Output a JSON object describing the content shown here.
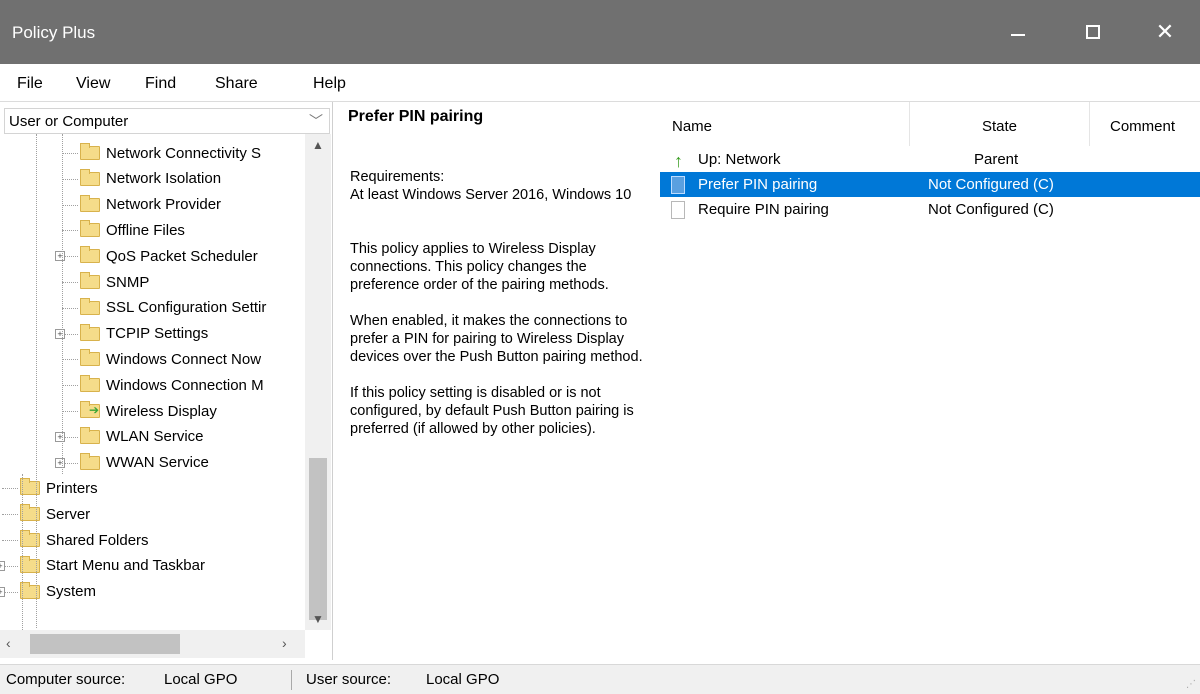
{
  "window": {
    "title": "Policy Plus"
  },
  "menu": [
    "File",
    "View",
    "Find",
    "Share",
    "Help"
  ],
  "tree": {
    "combo_value": "User or Computer",
    "items": [
      {
        "label": "Network Connectivity S",
        "indent": 1
      },
      {
        "label": "Network Isolation",
        "indent": 1
      },
      {
        "label": "Network Provider",
        "indent": 1
      },
      {
        "label": "Offline Files",
        "indent": 1
      },
      {
        "label": "QoS Packet Scheduler",
        "indent": 1,
        "expander": "+"
      },
      {
        "label": "SNMP",
        "indent": 1
      },
      {
        "label": "SSL Configuration Settir",
        "indent": 1
      },
      {
        "label": "TCPIP Settings",
        "indent": 1,
        "expander": "+"
      },
      {
        "label": "Windows Connect Now",
        "indent": 1
      },
      {
        "label": "Windows Connection M",
        "indent": 1
      },
      {
        "label": "Wireless Display",
        "indent": 1,
        "selected": true
      },
      {
        "label": "WLAN Service",
        "indent": 1,
        "expander": "+"
      },
      {
        "label": "WWAN Service",
        "indent": 1,
        "expander": "+"
      },
      {
        "label": "Printers",
        "indent": 0
      },
      {
        "label": "Server",
        "indent": 0
      },
      {
        "label": "Shared Folders",
        "indent": 0
      },
      {
        "label": "Start Menu and Taskbar",
        "indent": 0,
        "expander": "+"
      },
      {
        "label": "System",
        "indent": 0,
        "expander": "+"
      }
    ]
  },
  "description": {
    "title": "Prefer PIN pairing",
    "requirements_label": "Requirements:",
    "requirements_value": "At least Windows Server 2016, Windows 10",
    "para1": "This policy applies to Wireless Display connections. This policy changes the preference order of the pairing methods.",
    "para2": "When enabled, it makes the connections to prefer a PIN for pairing to Wireless Display devices over the Push Button pairing method.",
    "para3": "If this policy setting is disabled or is not configured, by default Push Button pairing is preferred (if allowed by other policies)."
  },
  "list": {
    "headers": {
      "name": "Name",
      "state": "State",
      "comment": "Comment"
    },
    "rows": [
      {
        "name": "Up: Network",
        "state": "Parent",
        "kind": "up"
      },
      {
        "name": "Prefer PIN pairing",
        "state": "Not Configured (C)",
        "kind": "policy",
        "selected": true
      },
      {
        "name": "Require PIN pairing",
        "state": "Not Configured (C)",
        "kind": "policy"
      }
    ]
  },
  "status": {
    "computer_label": "Computer source:",
    "computer_value": "Local GPO",
    "user_label": "User source:",
    "user_value": "Local GPO"
  },
  "colors": {
    "titlebar": "#707070",
    "selection": "#0078d7"
  }
}
